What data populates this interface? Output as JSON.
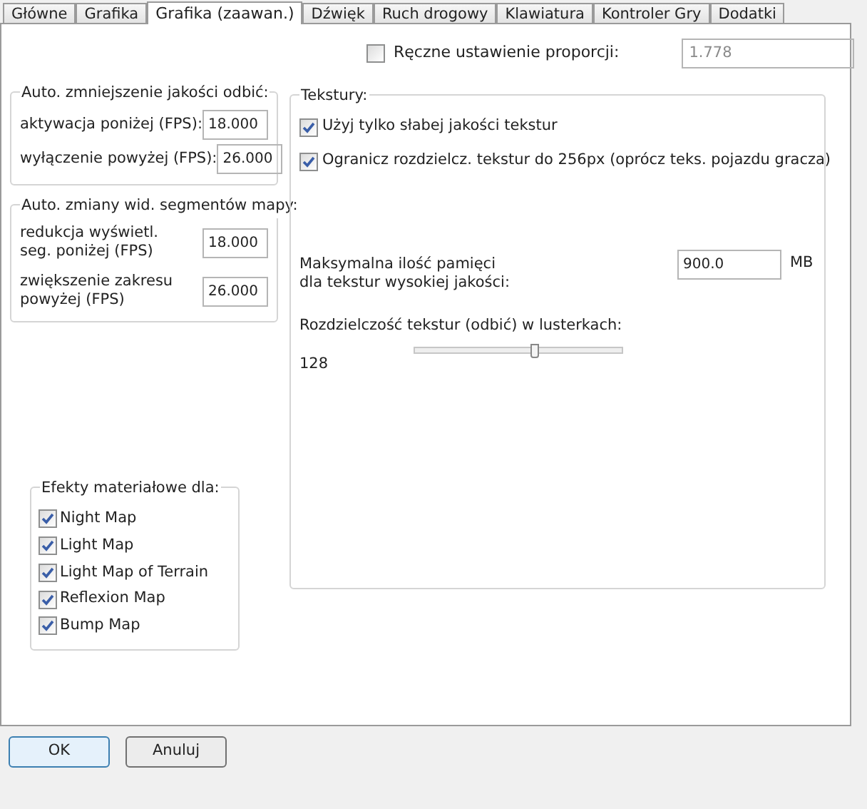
{
  "tabs": [
    {
      "label": "Główne",
      "selected": false
    },
    {
      "label": "Grafika",
      "selected": false
    },
    {
      "label": "Grafika (zaawan.)",
      "selected": true
    },
    {
      "label": "Dźwięk",
      "selected": false
    },
    {
      "label": "Ruch drogowy",
      "selected": false
    },
    {
      "label": "Klawiatura",
      "selected": false
    },
    {
      "label": "Kontroler Gry",
      "selected": false
    },
    {
      "label": "Dodatki",
      "selected": false
    }
  ],
  "aspect": {
    "label": "Ręczne ustawienie proporcji:",
    "checked": false,
    "value": "1.778"
  },
  "reflection_group": {
    "title": "Auto. zmniejszenie jakości odbić:",
    "fields": [
      {
        "label": "aktywacja poniżej (FPS):",
        "value": "18.000"
      },
      {
        "label": "wyłączenie powyżej (FPS):",
        "value": "26.000"
      }
    ]
  },
  "segments_group": {
    "title": "Auto. zmiany wid. segmentów mapy:",
    "fields": [
      {
        "label": "redukcja wyświetl. seg. poniżej (FPS)",
        "value": "18.000"
      },
      {
        "label": "zwiększenie zakresu powyżej (FPS)",
        "value": "26.000"
      }
    ]
  },
  "textures": {
    "title": "Tekstury:",
    "options": [
      {
        "label": "Użyj tylko słabej jakości tekstur",
        "checked": true
      },
      {
        "label": "Ogranicz rozdzielcz. tekstur do 256px (oprócz teks. pojazdu gracza)",
        "checked": true
      }
    ],
    "memory_label": "Maksymalna ilość pamięci dla tekstur wysokiej jakości:",
    "memory_value": "900.0",
    "memory_unit": "MB",
    "mirror_label": "Rozdzielczość tekstur (odbić) w lusterkach:",
    "mirror_value": "128",
    "mirror_slider": {
      "level": 0.58
    }
  },
  "materials": {
    "title": "Efekty materiałowe dla:",
    "items": [
      {
        "label": "Night Map",
        "checked": true
      },
      {
        "label": "Light Map",
        "checked": true
      },
      {
        "label": "Light Map of Terrain",
        "checked": true
      },
      {
        "label": "Reflexion Map",
        "checked": true
      },
      {
        "label": "Bump Map",
        "checked": true
      }
    ]
  },
  "buttons": [
    {
      "label": "OK",
      "default": true
    },
    {
      "label": "Anuluj",
      "default": false
    }
  ]
}
